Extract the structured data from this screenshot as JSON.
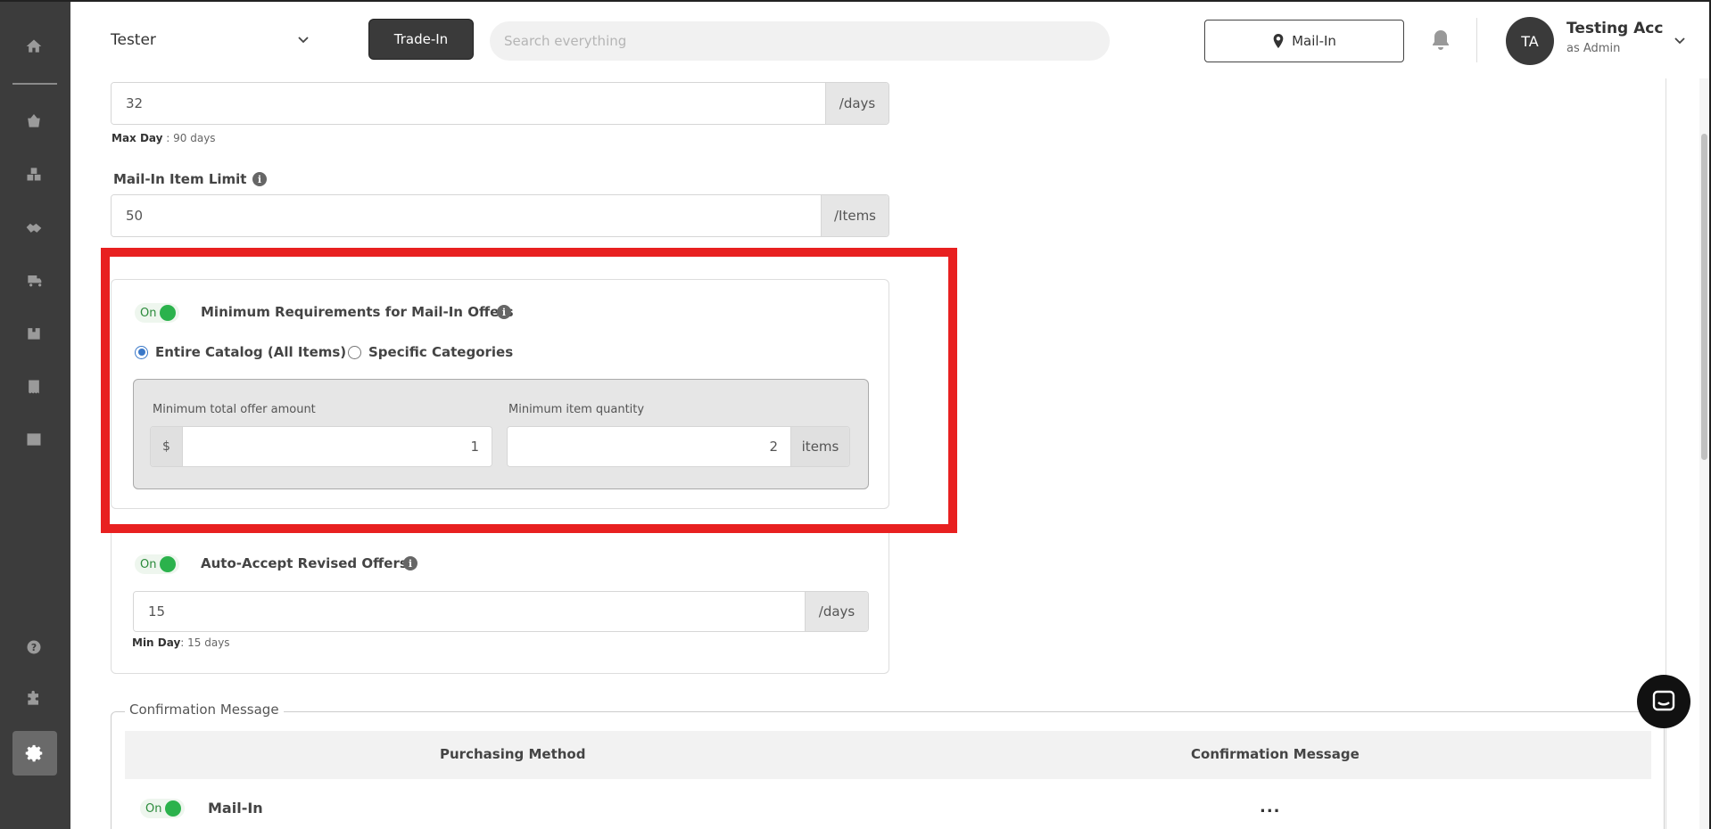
{
  "header": {
    "store_name": "Tester",
    "trade_in_label": "Trade-In",
    "search_placeholder": "Search everything",
    "mail_in_label": "Mail-In",
    "user": {
      "initials": "TA",
      "name": "Testing Acc",
      "role": "as Admin"
    }
  },
  "sidebar": {
    "items": [
      {
        "icon": "home-icon"
      },
      {
        "icon": "basket-icon"
      },
      {
        "icon": "boxes-icon"
      },
      {
        "icon": "handshake-icon"
      },
      {
        "icon": "delivery-icon"
      },
      {
        "icon": "box-icon"
      },
      {
        "icon": "receipt-icon"
      },
      {
        "icon": "storefront-icon"
      },
      {
        "icon": "help-icon"
      },
      {
        "icon": "puzzle-icon"
      },
      {
        "icon": "gear-icon"
      }
    ]
  },
  "settings": {
    "offer_expiry": {
      "value": "32",
      "suffix": "/days",
      "hint_label": "Max Day",
      "hint_value": " : 90 days"
    },
    "item_limit": {
      "label": "Mail-In Item Limit",
      "value": "50",
      "suffix": "/Items"
    },
    "min_requirements": {
      "toggle_label": "On",
      "title": "Minimum Requirements for Mail-In Offers",
      "option_entire": "Entire Catalog (All Items)",
      "option_specific": "Specific Categories",
      "min_amount_label": "Minimum total offer amount",
      "min_amount_prefix": "$",
      "min_amount_value": "1",
      "min_qty_label": "Minimum item quantity",
      "min_qty_value": "2",
      "min_qty_suffix": "items"
    },
    "auto_accept": {
      "toggle_label": "On",
      "title": "Auto-Accept Revised Offers",
      "value": "15",
      "suffix": "/days",
      "hint_label": "Min Day",
      "hint_value": ": 15 days"
    },
    "confirmation": {
      "legend": "Confirmation Message",
      "col_method": "Purchasing Method",
      "col_message": "Confirmation Message",
      "rows": [
        {
          "toggle_label": "On",
          "method": "Mail-In",
          "message": "..."
        }
      ]
    }
  },
  "colors": {
    "highlight": "#e82020",
    "toggle_on": "#2bb24c",
    "radio_selected": "#3a78c8",
    "sidebar_bg": "#3c3c3c"
  }
}
